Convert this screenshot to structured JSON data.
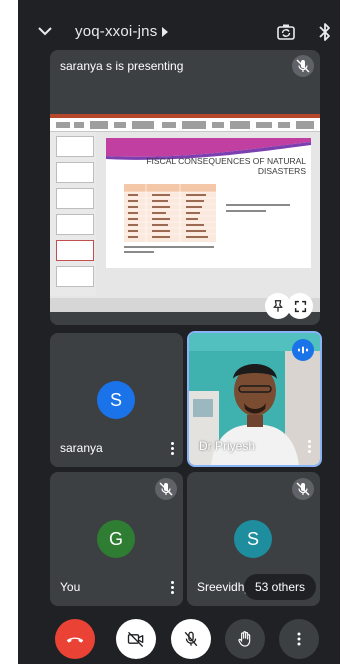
{
  "header": {
    "meeting_code": "yoq-xxoi-jns",
    "icons": [
      "chevron-down-icon",
      "caret-right-icon",
      "switch-camera-icon",
      "bluetooth-icon"
    ]
  },
  "presentation": {
    "label": "saranya s is presenting",
    "slide_title": "FISCAL CONSEQUENCES OF NATURAL DISASTERS"
  },
  "participants": [
    {
      "name": "saranya",
      "initial": "S",
      "avatar_color": "#1a73e8",
      "muted": false
    },
    {
      "name": "Dr Priyesh",
      "video": true,
      "speaking": true
    },
    {
      "name": "You",
      "initial": "G",
      "avatar_color": "#2e7d32",
      "muted": true
    },
    {
      "name": "Sreevidhy",
      "initial": "S",
      "avatar_color": "#1e8e9e",
      "muted": true
    }
  ],
  "others_label": "53 others",
  "controls": {
    "end_call_color": "#ea4335",
    "items": [
      "end-call-icon",
      "camera-off-icon",
      "mic-off-icon",
      "raise-hand-icon",
      "more-options-icon"
    ]
  }
}
